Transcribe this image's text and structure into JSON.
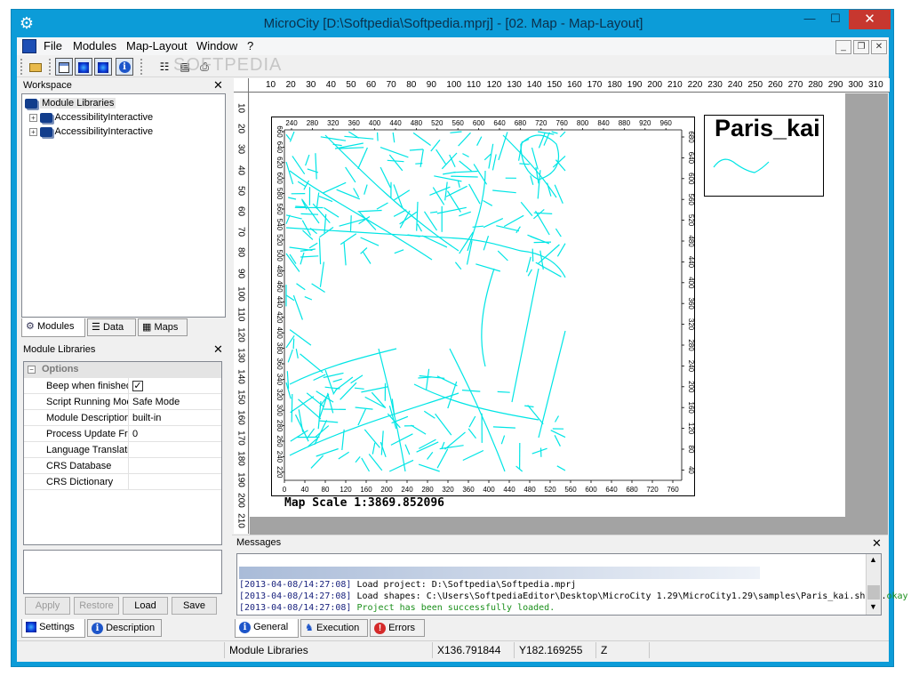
{
  "window": {
    "title": "MicroCity [D:\\Softpedia\\Softpedia.mprj] - [02. Map - Map-Layout]",
    "minimize": "—",
    "maximize": "☐",
    "close": "✕"
  },
  "menu": {
    "items": [
      "File",
      "Modules",
      "Map-Layout",
      "Window",
      "?"
    ],
    "mdi_minimize": "_",
    "mdi_restore": "❐",
    "mdi_close": "✕"
  },
  "watermark": "SOFTPEDIA",
  "workspace": {
    "title": "Workspace",
    "root_label": "Module Libraries",
    "items": [
      "AccessibilityInteractive",
      "AccessibilityInteractive"
    ],
    "tabs": [
      "Modules",
      "Data",
      "Maps"
    ]
  },
  "module_libraries": {
    "title": "Module Libraries",
    "section": "Options",
    "rows": [
      {
        "label": "Beep when finished",
        "value": "",
        "checked": true
      },
      {
        "label": "Script Running Mode",
        "value": "Safe Mode"
      },
      {
        "label": "Module Description",
        "value": "built-in"
      },
      {
        "label": "Process Update Frequency",
        "value": "0"
      },
      {
        "label": "Language Translations",
        "value": ""
      },
      {
        "label": "CRS Database",
        "value": ""
      },
      {
        "label": "CRS Dictionary",
        "value": ""
      }
    ],
    "buttons": {
      "apply": "Apply",
      "restore": "Restore",
      "load": "Load",
      "save": "Save"
    },
    "tabs": [
      "Settings",
      "Description"
    ]
  },
  "ruler": {
    "horizontal": [
      "10",
      "20",
      "30",
      "40",
      "50",
      "60",
      "70",
      "80",
      "90",
      "100",
      "110",
      "120",
      "130",
      "140",
      "150",
      "160",
      "170",
      "180",
      "190",
      "200",
      "210",
      "220",
      "230",
      "240",
      "250",
      "260",
      "270",
      "280",
      "290",
      "300",
      "310"
    ],
    "vertical": [
      "10",
      "20",
      "30",
      "40",
      "50",
      "60",
      "70",
      "80",
      "90",
      "100",
      "110",
      "120",
      "130",
      "140",
      "150",
      "160",
      "170",
      "180",
      "190",
      "200",
      "210"
    ]
  },
  "map": {
    "top_axis": [
      "240",
      "280",
      "320",
      "360",
      "400",
      "440",
      "480",
      "520",
      "560",
      "600",
      "640",
      "680",
      "720",
      "760",
      "800",
      "840",
      "880",
      "920",
      "960"
    ],
    "bottom_axis": [
      "0",
      "40",
      "80",
      "120",
      "160",
      "200",
      "240",
      "280",
      "320",
      "360",
      "400",
      "440",
      "480",
      "520",
      "560",
      "600",
      "640",
      "680",
      "720",
      "760"
    ],
    "left_axis": [
      "660",
      "640",
      "620",
      "600",
      "580",
      "560",
      "540",
      "520",
      "500",
      "480",
      "460",
      "440",
      "420",
      "400",
      "380",
      "360",
      "340",
      "320",
      "300",
      "280",
      "260",
      "240",
      "220"
    ],
    "right_axis": [
      "680",
      "640",
      "600",
      "560",
      "520",
      "480",
      "440",
      "400",
      "360",
      "320",
      "280",
      "240",
      "200",
      "160",
      "120",
      "80",
      "40"
    ],
    "scale_text": "Map Scale 1:3869.852096",
    "road_color": "#00e5e5",
    "legend_title": "Paris_kai"
  },
  "messages": {
    "title": "Messages",
    "lines": [
      {
        "time": "[2013-04-08/14:27:08]",
        "text": "Load project: D:\\Softpedia\\Softpedia.mprj",
        "suffix": ""
      },
      {
        "time": "[2013-04-08/14:27:08]",
        "text": "Load shapes: C:\\Users\\SoftpediaEditor\\Desktop\\MicroCity 1.29\\MicroCity1.29\\samples\\Paris_kai.shp...",
        "suffix": "okay"
      },
      {
        "time": "[2013-04-08/14:27:08]",
        "text": "Project has been successfully loaded.",
        "suffix": ""
      }
    ],
    "tabs": [
      "General",
      "Execution",
      "Errors"
    ]
  },
  "status": {
    "module": "Module Libraries",
    "x": "X136.791844",
    "y": "Y182.169255",
    "z": "Z"
  },
  "colors": {
    "title_bar": "#0c9cd8",
    "close_button": "#c7372f",
    "message_time": "#1a237e",
    "message_success": "#1a8f1a"
  }
}
